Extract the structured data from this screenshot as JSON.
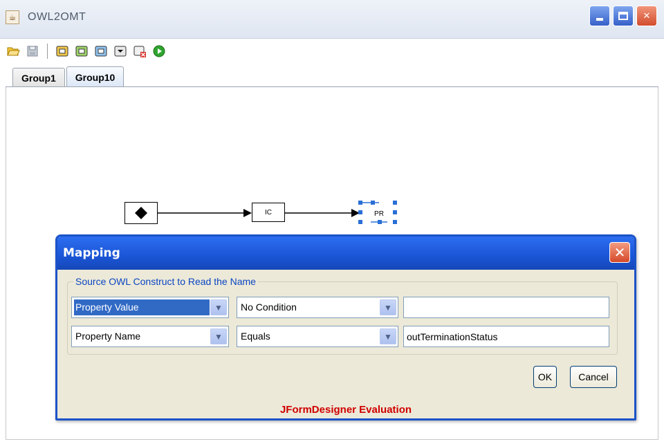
{
  "window": {
    "title": "OWL2OMT",
    "icon": "java-cup-icon",
    "controls": [
      "minimize-icon",
      "maximize-icon",
      "close-icon"
    ]
  },
  "toolbar": {
    "icons": [
      "open-folder-icon",
      "save-icon",
      "node-add-icon",
      "node-input-icon",
      "node-output-icon",
      "node-merge-icon",
      "node-delete-icon",
      "run-icon"
    ]
  },
  "tabs": [
    {
      "label": "Group1",
      "active": false
    },
    {
      "label": "Group10",
      "active": true
    }
  ],
  "diagram": {
    "nodes": [
      "",
      "IC",
      "PR"
    ]
  },
  "dialog": {
    "title": "Mapping",
    "group_label": "Source OWL Construct to Read the Name",
    "rows": [
      {
        "source": "Property Value",
        "condition": "No Condition",
        "value": ""
      },
      {
        "source": "Property Name",
        "condition": "Equals",
        "value": "outTerminationStatus"
      }
    ],
    "ok_label": "OK",
    "cancel_label": "Cancel",
    "watermark": "JFormDesigner Evaluation"
  },
  "colors": {
    "dialog_titlebar": "#1a55d6",
    "group_label": "#0a45c2",
    "watermark": "#d00000",
    "selection": "#316ac5"
  }
}
